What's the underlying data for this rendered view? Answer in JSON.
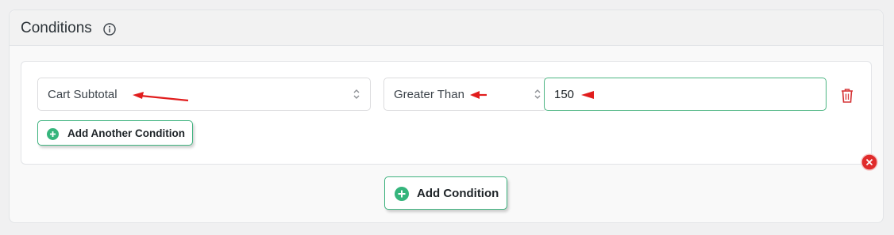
{
  "panel": {
    "title": "Conditions",
    "info_icon": "info-circle-icon"
  },
  "condition": {
    "field": {
      "value": "Cart Subtotal",
      "icon": "chevron-up-down-icon"
    },
    "operator": {
      "value": "Greater Than",
      "icon": "chevron-up-down-icon"
    },
    "amount": {
      "value": "150"
    },
    "delete_icon": "trash-icon",
    "add_another_label": "Add Another Condition",
    "remove_group_icon": "close-circle-icon"
  },
  "footer": {
    "add_condition_label": "Add Condition",
    "add_icon": "plus-circle-icon"
  },
  "annotation_arrows": {
    "color": "#e11d1d",
    "icon": "red-arrow-icon"
  },
  "colors": {
    "accent": "#35b57c",
    "danger": "#d63638",
    "border": "#dcdcde"
  }
}
